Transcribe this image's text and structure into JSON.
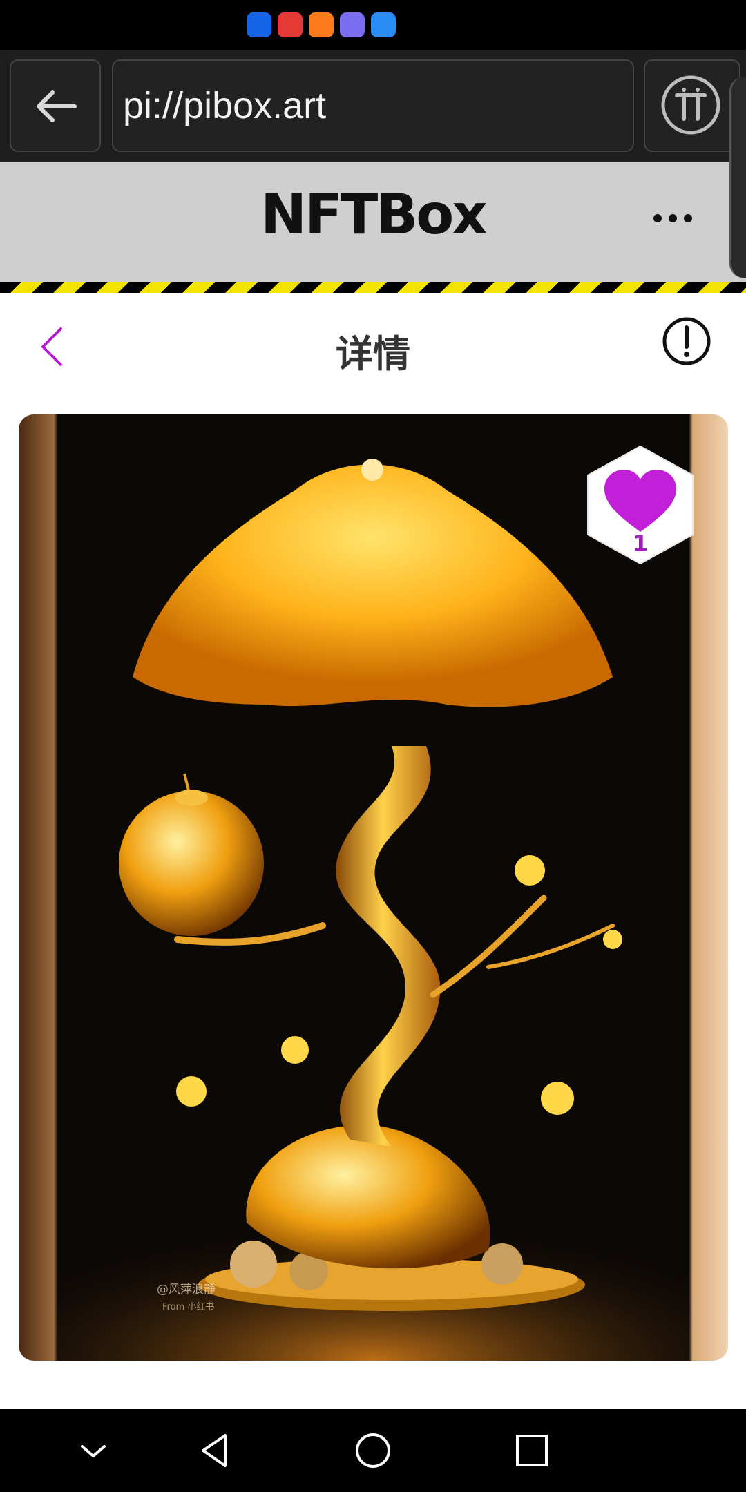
{
  "browser": {
    "url": "pi://pibox.art"
  },
  "app": {
    "title": "NFTBox"
  },
  "page": {
    "title": "详情"
  },
  "nft": {
    "likes": "1",
    "watermark_lines": [
      "@风萍浪静",
      "From 小红书"
    ]
  },
  "colors": {
    "accent": "#b21fd0",
    "hazard_yellow": "#f3e400",
    "header_bg": "#cfcfcf"
  },
  "icons": [
    "back-arrow-icon",
    "pi-network-icon",
    "more-icon",
    "chevron-left-icon",
    "info-icon",
    "heart-icon",
    "nav-collapse-icon",
    "nav-back-icon",
    "nav-home-icon",
    "nav-recents-icon"
  ]
}
